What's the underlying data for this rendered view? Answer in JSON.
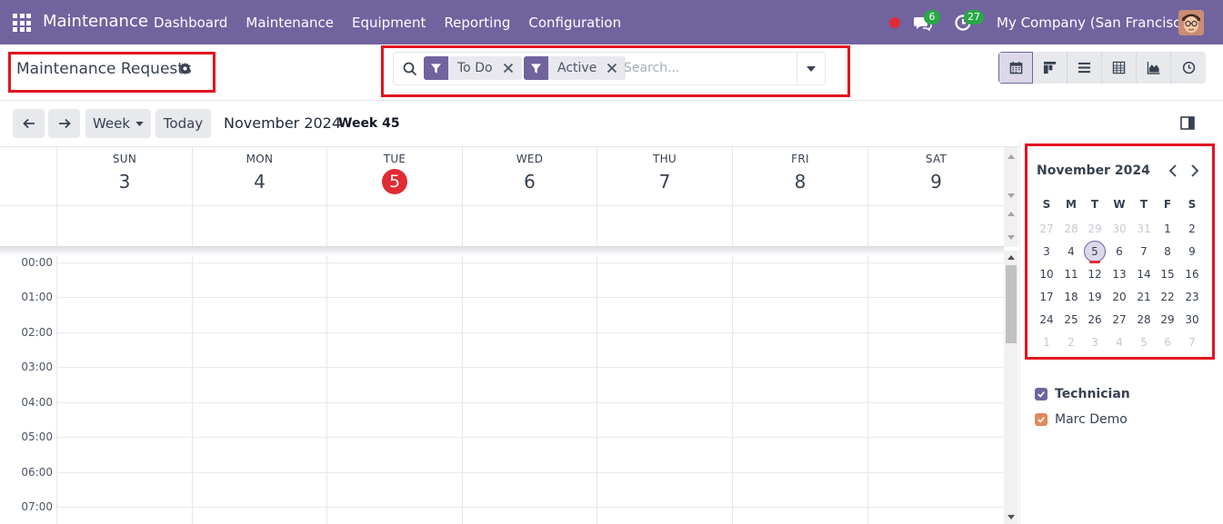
{
  "navbar": {
    "brand": "Maintenance",
    "menu": [
      "Dashboard",
      "Maintenance",
      "Equipment",
      "Reporting",
      "Configuration"
    ],
    "chat_count": "6",
    "activity_count": "27",
    "company": "My Company (San Francisco)"
  },
  "control_panel": {
    "title": "Maintenance Requests",
    "facets": [
      {
        "label": "To Do"
      },
      {
        "label": "Active"
      }
    ],
    "search_placeholder": "Search..."
  },
  "toolbar": {
    "scale_label": "Week",
    "today_label": "Today",
    "range_title": "November 2024",
    "week_label": "Week 45"
  },
  "week": {
    "days": [
      {
        "name": "SUN",
        "num": "3"
      },
      {
        "name": "MON",
        "num": "4"
      },
      {
        "name": "TUE",
        "num": "5",
        "today": true
      },
      {
        "name": "WED",
        "num": "6"
      },
      {
        "name": "THU",
        "num": "7"
      },
      {
        "name": "FRI",
        "num": "8"
      },
      {
        "name": "SAT",
        "num": "9"
      }
    ],
    "hours": [
      "00:00",
      "01:00",
      "02:00",
      "03:00",
      "04:00",
      "05:00",
      "06:00",
      "07:00"
    ]
  },
  "mini_calendar": {
    "title": "November 2024",
    "weekdays": [
      "S",
      "M",
      "T",
      "W",
      "T",
      "F",
      "S"
    ],
    "weeks": [
      [
        [
          "27",
          true
        ],
        [
          "28",
          true
        ],
        [
          "29",
          true
        ],
        [
          "30",
          true
        ],
        [
          "31",
          true
        ],
        [
          "1",
          false
        ],
        [
          "2",
          false
        ]
      ],
      [
        [
          "3",
          false
        ],
        [
          "4",
          false
        ],
        [
          "5",
          false
        ],
        [
          "6",
          false
        ],
        [
          "7",
          false
        ],
        [
          "8",
          false
        ],
        [
          "9",
          false
        ]
      ],
      [
        [
          "10",
          false
        ],
        [
          "11",
          false
        ],
        [
          "12",
          false
        ],
        [
          "13",
          false
        ],
        [
          "14",
          false
        ],
        [
          "15",
          false
        ],
        [
          "16",
          false
        ]
      ],
      [
        [
          "17",
          false
        ],
        [
          "18",
          false
        ],
        [
          "19",
          false
        ],
        [
          "20",
          false
        ],
        [
          "21",
          false
        ],
        [
          "22",
          false
        ],
        [
          "23",
          false
        ]
      ],
      [
        [
          "24",
          false
        ],
        [
          "25",
          false
        ],
        [
          "26",
          false
        ],
        [
          "27",
          false
        ],
        [
          "28",
          false
        ],
        [
          "29",
          false
        ],
        [
          "30",
          false
        ]
      ],
      [
        [
          "1",
          true
        ],
        [
          "2",
          true
        ],
        [
          "3",
          true
        ],
        [
          "4",
          true
        ],
        [
          "5",
          true
        ],
        [
          "6",
          true
        ],
        [
          "7",
          true
        ]
      ]
    ],
    "today": "5"
  },
  "filters": {
    "group_label": "Technician",
    "items": [
      {
        "label": "Marc Demo"
      }
    ]
  },
  "colors": {
    "brand": "#71639e",
    "today": "#e02b35",
    "badge": "#28a745",
    "filter_user": "#e08a5b"
  }
}
